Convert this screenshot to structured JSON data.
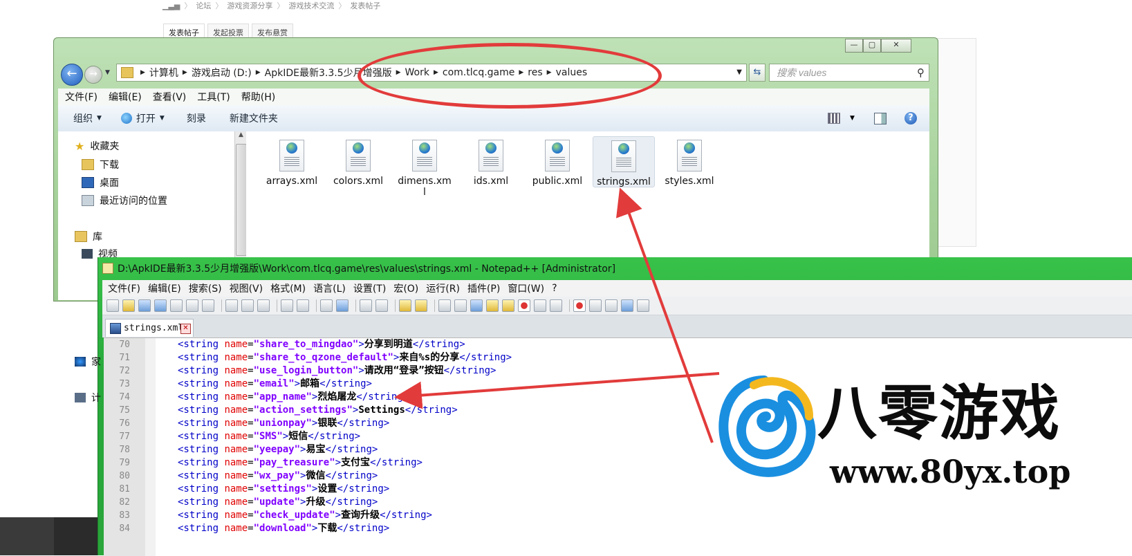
{
  "forum": {
    "breadcrumb": [
      "论坛",
      "游戏资源分享",
      "游戏技术交流",
      "发表帖子"
    ],
    "tabs": [
      "发表帖子",
      "发起投票",
      "发布悬赏"
    ]
  },
  "explorer": {
    "window_controls": {
      "minimize": "—",
      "maximize": "▢",
      "close": "✕"
    },
    "address": [
      "计算机",
      "游戏启动 (D:)",
      "ApkIDE最新3.3.5少月增强版",
      "Work",
      "com.tlcq.game",
      "res",
      "values"
    ],
    "search_placeholder": "搜索 values",
    "menu": [
      "文件(F)",
      "编辑(E)",
      "查看(V)",
      "工具(T)",
      "帮助(H)"
    ],
    "commands": {
      "organize": "组织",
      "open": "打开",
      "burn": "刻录",
      "new_folder": "新建文件夹"
    },
    "nav": {
      "favorites": "收藏夹",
      "downloads": "下载",
      "desktop": "桌面",
      "recent": "最近访问的位置",
      "libraries": "库",
      "videos": "视频",
      "homegroup_partial": "家",
      "computer_partial": "计"
    },
    "files": [
      "arrays.xml",
      "colors.xml",
      "dimens.xml",
      "ids.xml",
      "public.xml",
      "strings.xml",
      "styles.xml"
    ],
    "selected_file": "strings.xml"
  },
  "notepad": {
    "title": "D:\\ApkIDE最新3.3.5少月增强版\\Work\\com.tlcq.game\\res\\values\\strings.xml - Notepad++ [Administrator]",
    "menu": [
      "文件(F)",
      "编辑(E)",
      "搜索(S)",
      "视图(V)",
      "格式(M)",
      "语言(L)",
      "设置(T)",
      "宏(O)",
      "运行(R)",
      "插件(P)",
      "窗口(W)",
      "?"
    ],
    "tab": "strings.xml",
    "lines": [
      {
        "n": "70",
        "name": "share_to_mingdao",
        "text": "分享到明道"
      },
      {
        "n": "71",
        "name": "share_to_qzone_default",
        "text": "来自%s的分享"
      },
      {
        "n": "72",
        "name": "use_login_button",
        "text": "请改用“登录”按钮"
      },
      {
        "n": "73",
        "name": "email",
        "text": "邮箱"
      },
      {
        "n": "74",
        "name": "app_name",
        "text": "烈焰屠龙"
      },
      {
        "n": "75",
        "name": "action_settings",
        "text": "Settings"
      },
      {
        "n": "76",
        "name": "unionpay",
        "text": "银联"
      },
      {
        "n": "77",
        "name": "SMS",
        "text": "短信"
      },
      {
        "n": "78",
        "name": "yeepay",
        "text": "易宝"
      },
      {
        "n": "79",
        "name": "pay_treasure",
        "text": "支付宝"
      },
      {
        "n": "80",
        "name": "wx_pay",
        "text": "微信"
      },
      {
        "n": "81",
        "name": "settings",
        "text": "设置"
      },
      {
        "n": "82",
        "name": "update",
        "text": "升级"
      },
      {
        "n": "83",
        "name": "check_update",
        "text": "查询升级"
      },
      {
        "n": "84",
        "name": "download",
        "text": "下载"
      }
    ]
  },
  "watermark": {
    "brand": "八零游戏",
    "url": "www.80yx.top"
  },
  "colors": {
    "annotation_red": "#e23b3b",
    "win7_green": "#a6d19a",
    "npp_green": "#2aa63b",
    "xml_tag": "#0000c8",
    "xml_attr": "#e00000",
    "xml_value": "#8000ff"
  }
}
